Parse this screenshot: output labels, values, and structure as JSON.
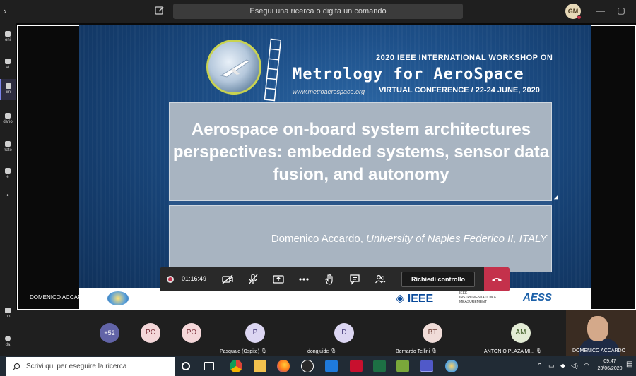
{
  "titlebar": {
    "search_placeholder": "Esegui una ricerca o digita un comando",
    "user_initials": "GM"
  },
  "rail": {
    "items": [
      {
        "label": "oni",
        "icon": "bell-icon"
      },
      {
        "label": "at",
        "icon": "chat-icon"
      },
      {
        "label": "im",
        "icon": "teams-icon"
      },
      {
        "label": "dario",
        "icon": "calendar-icon"
      },
      {
        "label": "nate",
        "icon": "phone-icon"
      },
      {
        "label": "e",
        "icon": "files-icon"
      },
      {
        "label": "•",
        "icon": "more-icon"
      },
      {
        "label": "pp",
        "icon": "apps-icon"
      },
      {
        "label": "da",
        "icon": "help-icon"
      }
    ]
  },
  "slide": {
    "workshop_line1": "2020 IEEE INTERNATIONAL WORKSHOP ON",
    "workshop_name": "Metrology for AeroSpace",
    "workshop_url": "www.metroaerospace.org",
    "workshop_virtual": "VIRTUAL CONFERENCE / 22-24 JUNE, 2020",
    "title": "Aerospace on-board system architectures perspectives: embedded systems, sensor data fusion, and autonomy",
    "author_name": "Domenico Accardo,",
    "author_affiliation": "University of Naples Federico II, ITALY",
    "footer_ieee": "IEEE",
    "footer_im": "IEEE INSTRUMENTATION & MEASUREMENT",
    "footer_aess": "AESS"
  },
  "stage": {
    "presenter_label": "DOMENICO ACCARDO"
  },
  "controls": {
    "timer": "01:16:49",
    "request_control_label": "Richiedi controllo"
  },
  "participants": {
    "overflow_count": "+52",
    "tiles": [
      {
        "initials": "PC",
        "name": ""
      },
      {
        "initials": "PO",
        "name": ""
      },
      {
        "initials": "P",
        "name": "Pasquale (Ospite)"
      },
      {
        "initials": "D",
        "name": "dongjuide"
      },
      {
        "initials": "BT",
        "name": "Bernardo Tellini"
      },
      {
        "initials": "AM",
        "name": "ANTONIO PLAZA MI..."
      }
    ],
    "self_label": "DOMENICO ACCARDO"
  },
  "taskbar": {
    "search_placeholder": "Scrivi qui per eseguire la ricerca",
    "time": "09:47",
    "date": "23/06/2020"
  },
  "colors": {
    "accent": "#7b83eb",
    "hangup": "#c4314b",
    "slide_bg": "#1d4f88",
    "title_panel": "#a8b4c1"
  }
}
